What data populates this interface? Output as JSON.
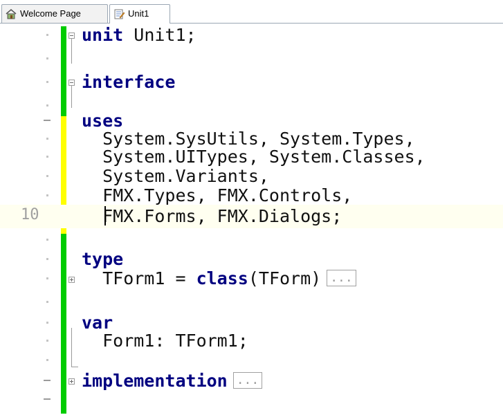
{
  "tabs": [
    {
      "label": "Welcome Page",
      "icon": "home-icon",
      "active": false
    },
    {
      "label": "Unit1",
      "icon": "unit-file-icon",
      "active": true
    }
  ],
  "editor": {
    "line_number_shown": "10",
    "collapsed_marker": "...",
    "lines": [
      {
        "kw": "unit",
        "rest": " Unit1;"
      },
      {
        "text": ""
      },
      {
        "kw": "interface",
        "rest": ""
      },
      {
        "text": ""
      },
      {
        "kw": "uses",
        "rest": ""
      },
      {
        "text": "  System.SysUtils, System.Types,"
      },
      {
        "text": "  System.UITypes, System.Classes,"
      },
      {
        "text": "  System.Variants,"
      },
      {
        "text": "  FMX.Types, FMX.Controls,"
      },
      {
        "text": "  FMX.Forms, FMX.Dialogs;"
      },
      {
        "text": ""
      },
      {
        "kw": "type",
        "rest": ""
      },
      {
        "pre": "  TForm1 = ",
        "kw": "class",
        "rest": "(TForm)"
      },
      {
        "text": ""
      },
      {
        "kw": "var",
        "rest": ""
      },
      {
        "text": "  Form1: TForm1;"
      },
      {
        "text": ""
      },
      {
        "kw": "implementation",
        "rest": ""
      }
    ]
  },
  "colors": {
    "saved_bar": "#00cc00",
    "modified_bar": "#ffff00",
    "keyword": "#000080",
    "current_line": "#fffff0"
  }
}
